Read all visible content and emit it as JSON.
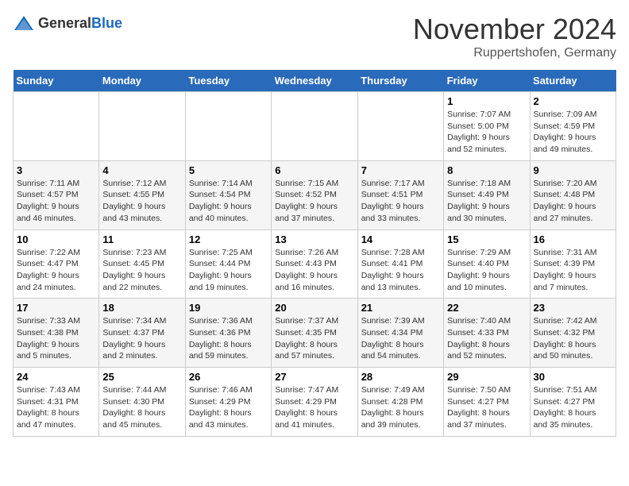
{
  "logo": {
    "general": "General",
    "blue": "Blue"
  },
  "header": {
    "month_year": "November 2024",
    "location": "Ruppertshofen, Germany"
  },
  "weekdays": [
    "Sunday",
    "Monday",
    "Tuesday",
    "Wednesday",
    "Thursday",
    "Friday",
    "Saturday"
  ],
  "weeks": [
    [
      {
        "day": "",
        "info": ""
      },
      {
        "day": "",
        "info": ""
      },
      {
        "day": "",
        "info": ""
      },
      {
        "day": "",
        "info": ""
      },
      {
        "day": "",
        "info": ""
      },
      {
        "day": "1",
        "info": "Sunrise: 7:07 AM\nSunset: 5:00 PM\nDaylight: 9 hours\nand 52 minutes."
      },
      {
        "day": "2",
        "info": "Sunrise: 7:09 AM\nSunset: 4:59 PM\nDaylight: 9 hours\nand 49 minutes."
      }
    ],
    [
      {
        "day": "3",
        "info": "Sunrise: 7:11 AM\nSunset: 4:57 PM\nDaylight: 9 hours\nand 46 minutes."
      },
      {
        "day": "4",
        "info": "Sunrise: 7:12 AM\nSunset: 4:55 PM\nDaylight: 9 hours\nand 43 minutes."
      },
      {
        "day": "5",
        "info": "Sunrise: 7:14 AM\nSunset: 4:54 PM\nDaylight: 9 hours\nand 40 minutes."
      },
      {
        "day": "6",
        "info": "Sunrise: 7:15 AM\nSunset: 4:52 PM\nDaylight: 9 hours\nand 37 minutes."
      },
      {
        "day": "7",
        "info": "Sunrise: 7:17 AM\nSunset: 4:51 PM\nDaylight: 9 hours\nand 33 minutes."
      },
      {
        "day": "8",
        "info": "Sunrise: 7:18 AM\nSunset: 4:49 PM\nDaylight: 9 hours\nand 30 minutes."
      },
      {
        "day": "9",
        "info": "Sunrise: 7:20 AM\nSunset: 4:48 PM\nDaylight: 9 hours\nand 27 minutes."
      }
    ],
    [
      {
        "day": "10",
        "info": "Sunrise: 7:22 AM\nSunset: 4:47 PM\nDaylight: 9 hours\nand 24 minutes."
      },
      {
        "day": "11",
        "info": "Sunrise: 7:23 AM\nSunset: 4:45 PM\nDaylight: 9 hours\nand 22 minutes."
      },
      {
        "day": "12",
        "info": "Sunrise: 7:25 AM\nSunset: 4:44 PM\nDaylight: 9 hours\nand 19 minutes."
      },
      {
        "day": "13",
        "info": "Sunrise: 7:26 AM\nSunset: 4:43 PM\nDaylight: 9 hours\nand 16 minutes."
      },
      {
        "day": "14",
        "info": "Sunrise: 7:28 AM\nSunset: 4:41 PM\nDaylight: 9 hours\nand 13 minutes."
      },
      {
        "day": "15",
        "info": "Sunrise: 7:29 AM\nSunset: 4:40 PM\nDaylight: 9 hours\nand 10 minutes."
      },
      {
        "day": "16",
        "info": "Sunrise: 7:31 AM\nSunset: 4:39 PM\nDaylight: 9 hours\nand 7 minutes."
      }
    ],
    [
      {
        "day": "17",
        "info": "Sunrise: 7:33 AM\nSunset: 4:38 PM\nDaylight: 9 hours\nand 5 minutes."
      },
      {
        "day": "18",
        "info": "Sunrise: 7:34 AM\nSunset: 4:37 PM\nDaylight: 9 hours\nand 2 minutes."
      },
      {
        "day": "19",
        "info": "Sunrise: 7:36 AM\nSunset: 4:36 PM\nDaylight: 8 hours\nand 59 minutes."
      },
      {
        "day": "20",
        "info": "Sunrise: 7:37 AM\nSunset: 4:35 PM\nDaylight: 8 hours\nand 57 minutes."
      },
      {
        "day": "21",
        "info": "Sunrise: 7:39 AM\nSunset: 4:34 PM\nDaylight: 8 hours\nand 54 minutes."
      },
      {
        "day": "22",
        "info": "Sunrise: 7:40 AM\nSunset: 4:33 PM\nDaylight: 8 hours\nand 52 minutes."
      },
      {
        "day": "23",
        "info": "Sunrise: 7:42 AM\nSunset: 4:32 PM\nDaylight: 8 hours\nand 50 minutes."
      }
    ],
    [
      {
        "day": "24",
        "info": "Sunrise: 7:43 AM\nSunset: 4:31 PM\nDaylight: 8 hours\nand 47 minutes."
      },
      {
        "day": "25",
        "info": "Sunrise: 7:44 AM\nSunset: 4:30 PM\nDaylight: 8 hours\nand 45 minutes."
      },
      {
        "day": "26",
        "info": "Sunrise: 7:46 AM\nSunset: 4:29 PM\nDaylight: 8 hours\nand 43 minutes."
      },
      {
        "day": "27",
        "info": "Sunrise: 7:47 AM\nSunset: 4:29 PM\nDaylight: 8 hours\nand 41 minutes."
      },
      {
        "day": "28",
        "info": "Sunrise: 7:49 AM\nSunset: 4:28 PM\nDaylight: 8 hours\nand 39 minutes."
      },
      {
        "day": "29",
        "info": "Sunrise: 7:50 AM\nSunset: 4:27 PM\nDaylight: 8 hours\nand 37 minutes."
      },
      {
        "day": "30",
        "info": "Sunrise: 7:51 AM\nSunset: 4:27 PM\nDaylight: 8 hours\nand 35 minutes."
      }
    ]
  ]
}
